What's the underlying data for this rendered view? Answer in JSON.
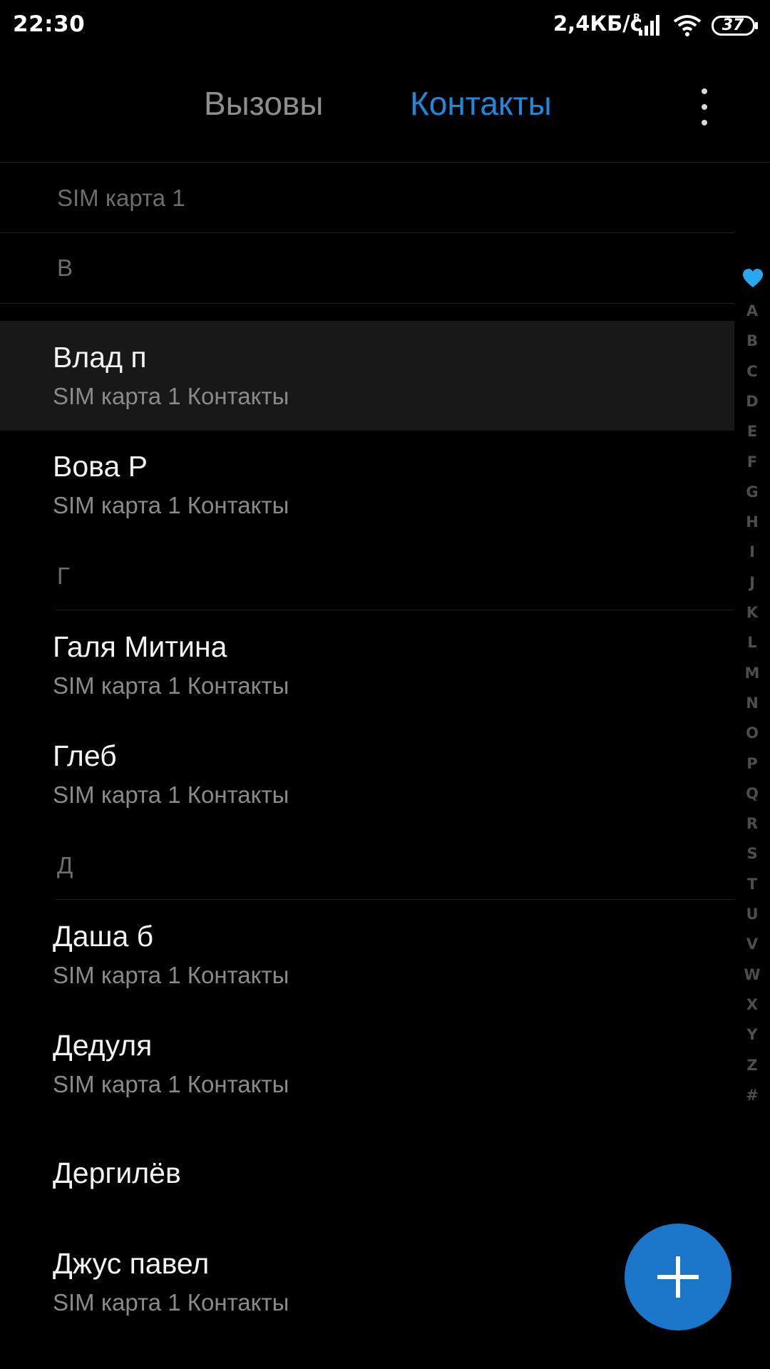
{
  "status_bar": {
    "time": "22:30",
    "network_speed": "2,4КБ/с",
    "roaming": "R",
    "battery": "37"
  },
  "tabs": {
    "calls_label": "Вызовы",
    "contacts_label": "Контакты",
    "active": "contacts"
  },
  "account_header": "SIM карта 1",
  "sections": [
    {
      "letter": "В"
    },
    {
      "letter": "Г"
    },
    {
      "letter": "Д"
    }
  ],
  "contacts": [
    {
      "name": "Влад п",
      "subtitle": "SIM карта 1 Контакты",
      "selected": true
    },
    {
      "name": "Вова Р",
      "subtitle": "SIM карта 1 Контакты"
    },
    {
      "name": "Галя Митина",
      "subtitle": "SIM карта 1 Контакты"
    },
    {
      "name": "Глеб",
      "subtitle": "SIM карта 1 Контакты"
    },
    {
      "name": "Даша б",
      "subtitle": "SIM карта 1 Контакты"
    },
    {
      "name": "Дедуля",
      "subtitle": "SIM карта 1 Контакты"
    },
    {
      "name": "Дергилёв",
      "subtitle": ""
    },
    {
      "name": "Джус павел",
      "subtitle": "SIM карта 1 Контакты"
    }
  ],
  "alphabet_index": [
    "A",
    "B",
    "C",
    "D",
    "E",
    "F",
    "G",
    "H",
    "I",
    "J",
    "K",
    "L",
    "M",
    "N",
    "O",
    "P",
    "Q",
    "R",
    "S",
    "T",
    "U",
    "V",
    "W",
    "X",
    "Y",
    "Z",
    "#"
  ],
  "colors": {
    "accent": "#1e88d9",
    "fab": "#1976c9",
    "favorites_heart": "#29a8f0"
  },
  "icons": {
    "favorites": "heart-icon",
    "fab": "plus-icon",
    "menu": "more-vertical-icon"
  }
}
